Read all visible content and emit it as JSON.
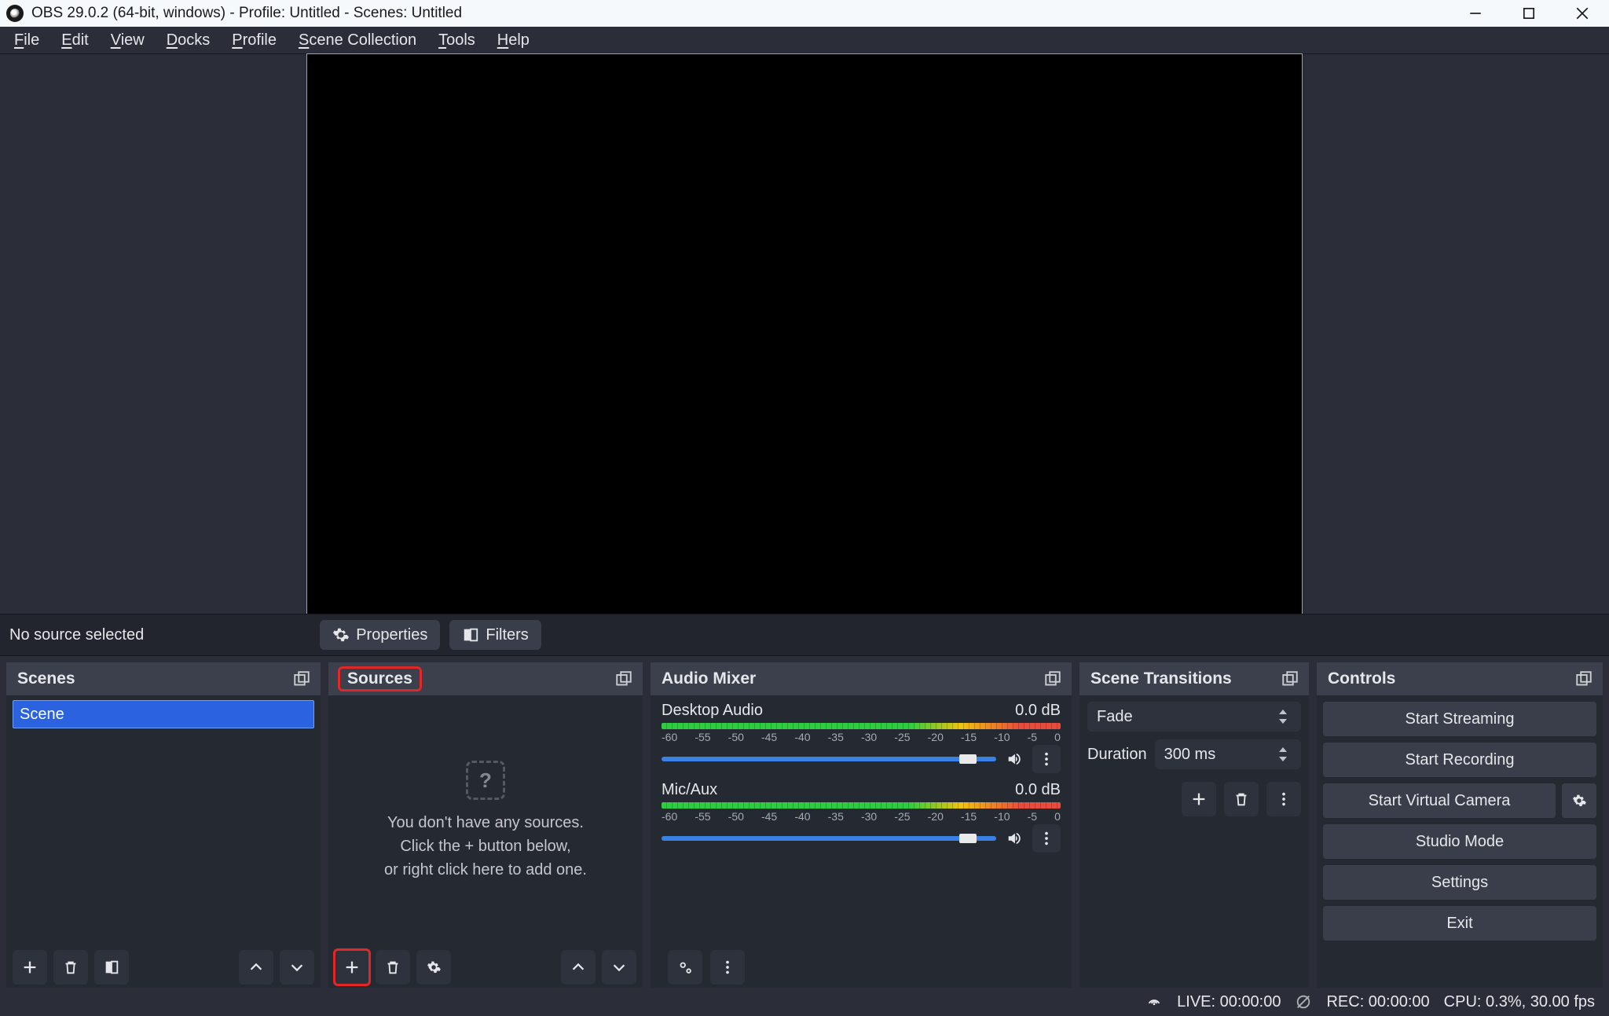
{
  "window": {
    "title": "OBS 29.0.2 (64-bit, windows) - Profile: Untitled - Scenes: Untitled"
  },
  "menu": {
    "items": [
      {
        "mnemonic": "F",
        "rest": "ile"
      },
      {
        "mnemonic": "E",
        "rest": "dit"
      },
      {
        "mnemonic": "V",
        "rest": "iew"
      },
      {
        "mnemonic": "D",
        "rest": "ocks"
      },
      {
        "mnemonic": "P",
        "rest": "rofile"
      },
      {
        "mnemonic": "S",
        "rest": "cene Collection"
      },
      {
        "mnemonic": "T",
        "rest": "ools"
      },
      {
        "mnemonic": "H",
        "rest": "elp"
      }
    ]
  },
  "center_toolbar": {
    "status": "No source selected",
    "properties": "Properties",
    "filters": "Filters"
  },
  "docks": {
    "scenes": {
      "title": "Scenes",
      "items": [
        "Scene"
      ]
    },
    "sources": {
      "title": "Sources",
      "empty_line1": "You don't have any sources.",
      "empty_line2": "Click the + button below,",
      "empty_line3": "or right click here to add one."
    },
    "mixer": {
      "title": "Audio Mixer",
      "ticks": [
        "-60",
        "-55",
        "-50",
        "-45",
        "-40",
        "-35",
        "-30",
        "-25",
        "-20",
        "-15",
        "-10",
        "-5",
        "0"
      ],
      "channels": [
        {
          "name": "Desktop Audio",
          "db": "0.0 dB"
        },
        {
          "name": "Mic/Aux",
          "db": "0.0 dB"
        }
      ]
    },
    "transitions": {
      "title": "Scene Transitions",
      "selected": "Fade",
      "duration_label": "Duration",
      "duration_value": "300 ms"
    },
    "controls": {
      "title": "Controls",
      "start_streaming": "Start Streaming",
      "start_recording": "Start Recording",
      "start_virtual_camera": "Start Virtual Camera",
      "studio_mode": "Studio Mode",
      "settings": "Settings",
      "exit": "Exit"
    }
  },
  "statusbar": {
    "live": "LIVE: 00:00:00",
    "rec": "REC: 00:00:00",
    "cpu": "CPU: 0.3%, 30.00 fps"
  },
  "highlights": {
    "sources_title": true,
    "add_source": true
  }
}
